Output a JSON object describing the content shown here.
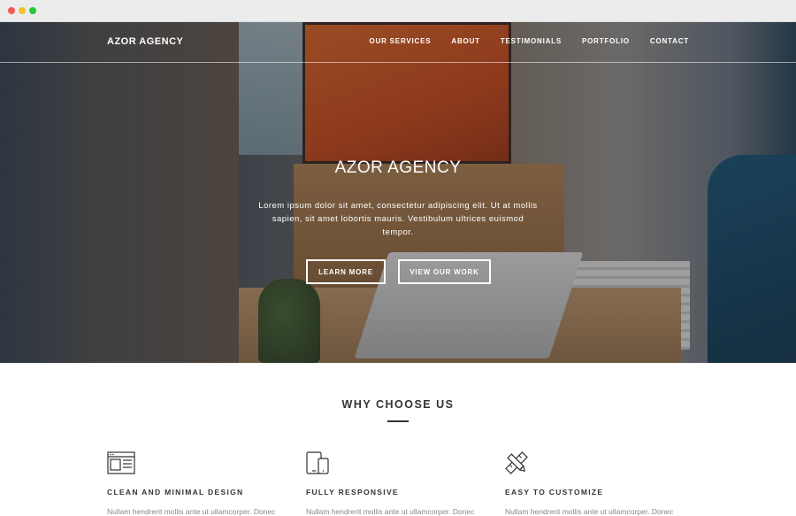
{
  "browser": {
    "controls": [
      "close",
      "minimize",
      "maximize"
    ]
  },
  "nav": {
    "brand": "AZOR AGENCY",
    "links": [
      "OUR SERVICES",
      "ABOUT",
      "TESTIMONIALS",
      "PORTFOLIO",
      "CONTACT"
    ]
  },
  "hero": {
    "title": "AZOR AGENCY",
    "text": "Lorem ipsum dolor sit amet, consectetur adipiscing elit. Ut at mollis sapien, sit amet lobortis mauris. Vestibulum ultrices euismod tempor.",
    "button_primary": "LEARN MORE",
    "button_secondary": "VIEW OUR WORK"
  },
  "why": {
    "title": "WHY CHOOSE US",
    "features": [
      {
        "icon": "layout-icon",
        "title": "CLEAN AND MINIMAL DESIGN",
        "text": "Nullam hendrerit mollis ante ut ullamcorper. Donec"
      },
      {
        "icon": "devices-icon",
        "title": "FULLY RESPONSIVE",
        "text": "Nullam hendrerit mollis ante ut ullamcorper. Donec"
      },
      {
        "icon": "pencil-ruler-icon",
        "title": "EASY TO CUSTOMIZE",
        "text": "Nullam hendrerit mollis ante ut ullamcorper. Donec"
      }
    ]
  },
  "colors": {
    "heading": "#333333",
    "muted": "#888888",
    "chrome_bg": "#ececec"
  }
}
